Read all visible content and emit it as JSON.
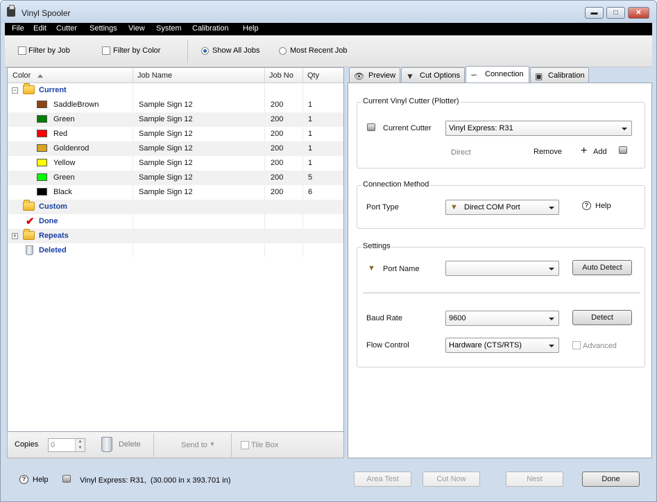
{
  "window": {
    "title": "Vinyl Spooler"
  },
  "menu": [
    "File",
    "Edit",
    "Cutter",
    "Settings",
    "View",
    "System",
    "Calibration",
    "Help"
  ],
  "toolbar": {
    "filter_by_job": "Filter by Job",
    "filter_by_color": "Filter by Color",
    "show_all_jobs": "Show All Jobs",
    "most_recent_job": "Most Recent Job",
    "selected_view": "Show All Jobs"
  },
  "table": {
    "headers": [
      "Color",
      "Job Name",
      "Job No",
      "Qty"
    ],
    "folders": {
      "current": "Current",
      "custom": "Custom",
      "done": "Done",
      "repeats": "Repeats",
      "deleted": "Deleted"
    },
    "rows": [
      {
        "color": "SaddleBrown",
        "swatch": "#8B4513",
        "job_name": "Sample Sign 12",
        "job_no": "200",
        "qty": "1"
      },
      {
        "color": "Green",
        "swatch": "#008000",
        "job_name": "Sample Sign 12",
        "job_no": "200",
        "qty": "1"
      },
      {
        "color": "Red",
        "swatch": "#FF0000",
        "job_name": "Sample Sign 12",
        "job_no": "200",
        "qty": "1"
      },
      {
        "color": "Goldenrod",
        "swatch": "#DAA520",
        "job_name": "Sample Sign 12",
        "job_no": "200",
        "qty": "1"
      },
      {
        "color": "Yellow",
        "swatch": "#FFFF00",
        "job_name": "Sample Sign 12",
        "job_no": "200",
        "qty": "1"
      },
      {
        "color": "Green",
        "swatch": "#00FF00",
        "job_name": "Sample Sign 12",
        "job_no": "200",
        "qty": "5"
      },
      {
        "color": "Black",
        "swatch": "#000000",
        "job_name": "Sample Sign 12",
        "job_no": "200",
        "qty": "6"
      }
    ]
  },
  "bottombar": {
    "copies_label": "Copies",
    "copies_value": "0",
    "delete_label": "Delete",
    "send_to_label": "Send to",
    "tile_box_label": "Tile Box"
  },
  "tabs": [
    "Preview",
    "Cut Options",
    "Connection",
    "Calibration"
  ],
  "active_tab": "Connection",
  "connection": {
    "current_cutter_group": "Current Vinyl Cutter (Plotter)",
    "current_cutter_label": "Current Cutter",
    "current_cutter_value": "Vinyl Express: R31",
    "direct_label": "Direct",
    "remove_label": "Remove",
    "add_label": "Add",
    "method_group": "Connection Method",
    "port_type_label": "Port Type",
    "port_type_value": "Direct COM Port",
    "help_label": "Help",
    "settings_group": "Settings",
    "port_name_label": "Port Name",
    "port_name_value": "",
    "auto_detect_label": "Auto Detect",
    "baud_rate_label": "Baud Rate",
    "baud_rate_value": "9600",
    "detect_label": "Detect",
    "flow_control_label": "Flow Control",
    "flow_control_value": "Hardware (CTS/RTS)",
    "advanced_label": "Advanced"
  },
  "footer": {
    "help_label": "Help",
    "status": "Vinyl Express: R31,  (30.000 in x 393.701 in)",
    "area_test": "Area Test",
    "cut_now": "Cut Now",
    "nest": "Nest",
    "done": "Done"
  },
  "colors": {
    "folder_text": "#1a3fa3",
    "title_bar": "#cfdcec",
    "menubar": "#000000"
  }
}
